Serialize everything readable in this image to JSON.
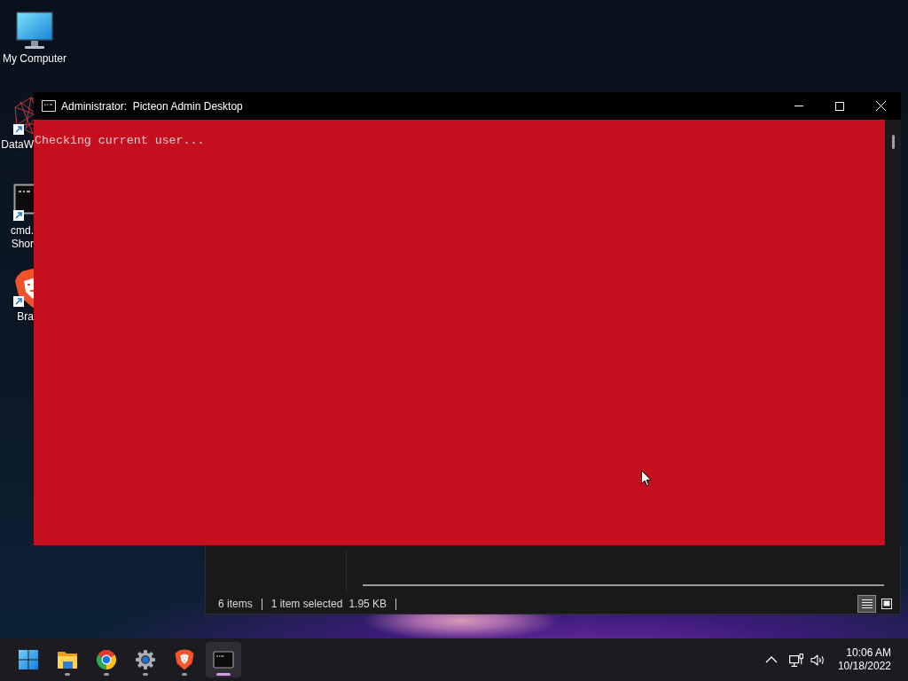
{
  "desktop_icons": [
    {
      "kind": "monitor",
      "label_lines": [
        "My Computer"
      ],
      "shortcut": false
    },
    {
      "kind": "wireframe",
      "label_lines": [
        "DataW"
      ],
      "shortcut": true
    },
    {
      "kind": "console",
      "label_lines": [
        "cmd.",
        "Shor"
      ],
      "shortcut": true
    },
    {
      "kind": "shield",
      "label_lines": [
        "Bra"
      ],
      "shortcut": true
    }
  ],
  "explorer_window": {
    "status_groups": [
      {
        "texts": [
          "6 items"
        ]
      },
      {
        "texts": [
          "1 item selected",
          "1.95 KB"
        ]
      }
    ],
    "view_buttons": [
      {
        "kind": "details",
        "selected": true
      },
      {
        "kind": "tiles",
        "selected": false
      }
    ]
  },
  "console_window": {
    "title": "Administrator:  Picteon Admin Desktop",
    "lines": [
      "Checking current user..."
    ]
  },
  "taskbar": {
    "items": [
      {
        "kind": "start",
        "running": false,
        "selected": false
      },
      {
        "kind": "folder",
        "running": true,
        "selected": false
      },
      {
        "kind": "browser",
        "running": true,
        "selected": false
      },
      {
        "kind": "settings",
        "running": true,
        "selected": false
      },
      {
        "kind": "shield",
        "running": true,
        "selected": false
      },
      {
        "kind": "terminal",
        "running": true,
        "selected": true
      }
    ],
    "clock": {
      "time": "10:06 AM",
      "date": "10/18/2022"
    }
  }
}
